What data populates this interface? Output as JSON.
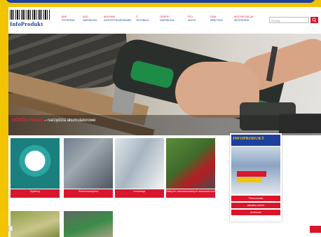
{
  "site": {
    "logo_text": "InfoProdukt"
  },
  "nav": {
    "items": [
      {
        "l1": "BHP",
        "l2": "OCHRONA"
      },
      {
        "l1": "AGD",
        "l2": "NARZĘDZIA"
      },
      {
        "l1": "BUDOWA",
        "l2": "ZAGOSPODAROWANIE"
      },
      {
        "l1": "IT",
        "l2": "TECHNIKA"
      },
      {
        "l1": "OGRÓD",
        "l2": "NARZĘDZIA"
      },
      {
        "l1": "RTV",
        "l2": "AUDIO"
      },
      {
        "l1": "DOM",
        "l2": "WNĘTRZA"
      },
      {
        "l1": "MOTORYZACJA",
        "l2": "AKCESORIA"
      }
    ]
  },
  "search": {
    "placeholder": "Szukaj..."
  },
  "hero": {
    "brand1": "OGRÓD",
    "brand2": "Hitachi",
    "caption": " – narzędzia akumulatorowe"
  },
  "tiles": [
    {
      "label": "Systemy"
    },
    {
      "label": "Elektronarzędzia"
    },
    {
      "label": "Innowacje"
    },
    {
      "label": "Nabycie zaawansowanych akumulatorów"
    }
  ],
  "magazine": {
    "title": "INFOPRODUKT",
    "buttons": [
      "Prenumerata",
      "aktualny numer",
      "Archiwum"
    ]
  },
  "colors": {
    "accent_red": "#d9162b",
    "brand_blue": "#1d3f9e",
    "frame_yellow": "#f2c400"
  }
}
